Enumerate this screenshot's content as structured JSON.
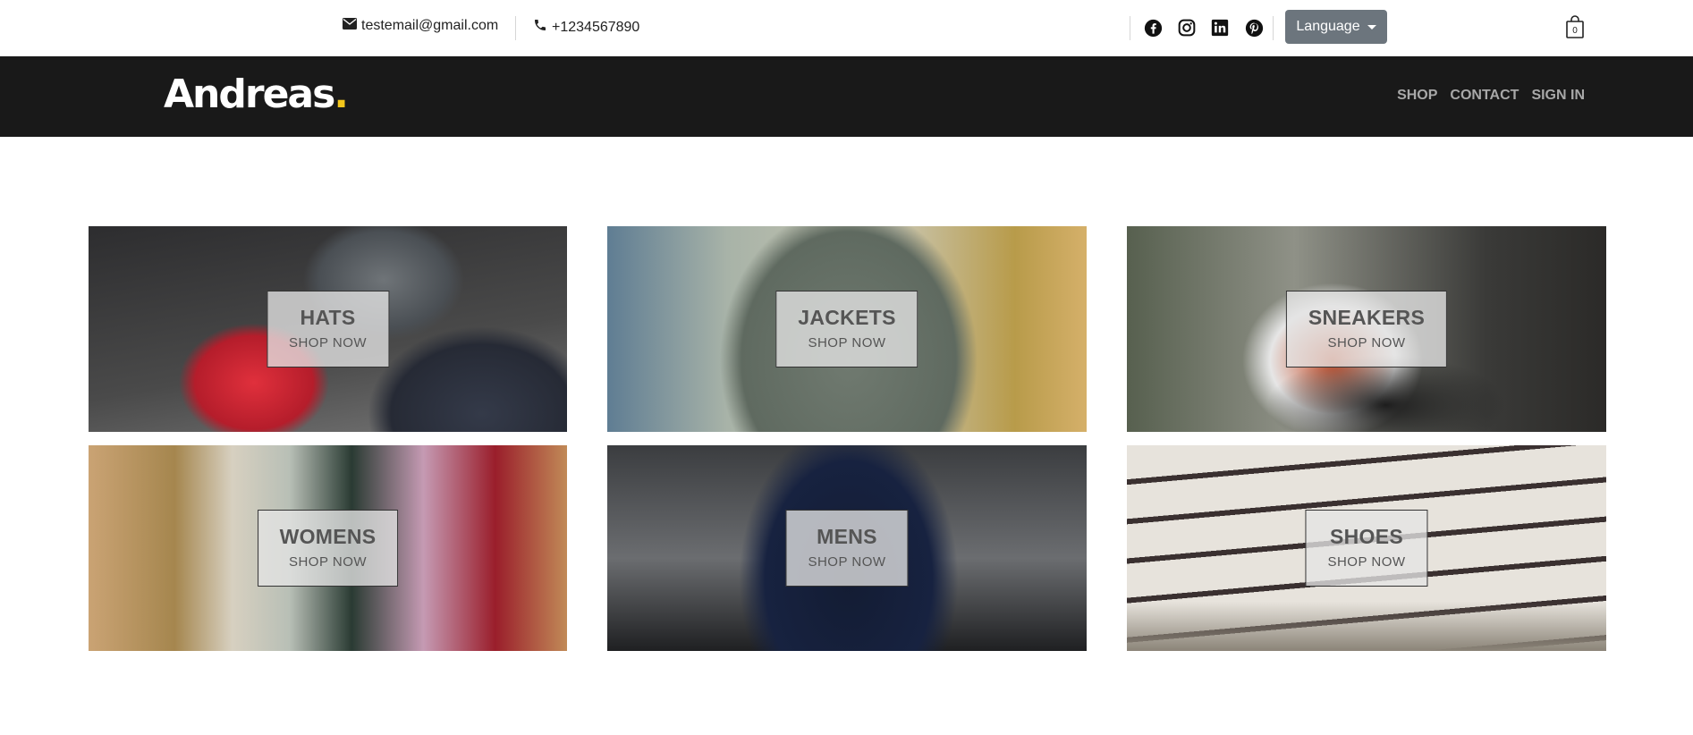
{
  "topbar": {
    "email": "testemail@gmail.com",
    "phone": "+1234567890",
    "social": [
      "facebook-icon",
      "instagram-icon",
      "linkedin-icon",
      "pinterest-icon"
    ],
    "language_label": "Language",
    "cart_count": "0"
  },
  "nav": {
    "logo_text": "Andreas",
    "logo_dot": ".",
    "links": [
      {
        "label": "SHOP"
      },
      {
        "label": "CONTACT"
      },
      {
        "label": "SIGN IN"
      }
    ]
  },
  "categories": [
    {
      "title": "HATS",
      "cta": "SHOP NOW"
    },
    {
      "title": "JACKETS",
      "cta": "SHOP NOW"
    },
    {
      "title": "SNEAKERS",
      "cta": "SHOP NOW"
    },
    {
      "title": "WOMENS",
      "cta": "SHOP NOW"
    },
    {
      "title": "MENS",
      "cta": "SHOP NOW"
    },
    {
      "title": "SHOES",
      "cta": "SHOP NOW"
    }
  ],
  "colors": {
    "nav_bg": "#191919",
    "accent": "#f3c61b",
    "language_button": "#6c757d"
  }
}
